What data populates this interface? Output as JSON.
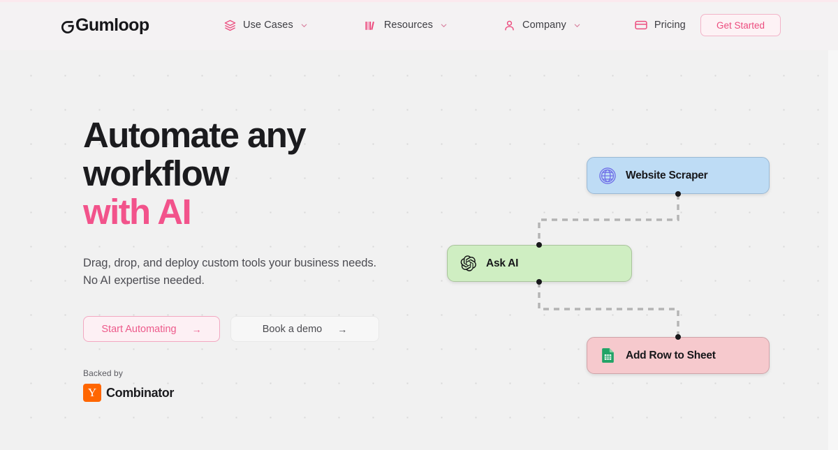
{
  "brand": {
    "name": "Gumloop",
    "accent_color": "#f2538b",
    "nav_icon_color": "#ec4c7e"
  },
  "header": {
    "nav_items": [
      {
        "label": "Use Cases",
        "icon": "layers-icon",
        "has_chevron": true
      },
      {
        "label": "Resources",
        "icon": "books-icon",
        "has_chevron": true
      },
      {
        "label": "Company",
        "icon": "person-icon",
        "has_chevron": true
      },
      {
        "label": "Pricing",
        "icon": "credit-card-icon",
        "has_chevron": false
      }
    ],
    "cta": {
      "label": "Get Started"
    }
  },
  "hero": {
    "headline_line1": "Automate any",
    "headline_line2": "workflow",
    "headline_accent": "with AI",
    "subtitle_line1": "Drag, drop, and deploy custom tools your business needs.",
    "subtitle_line2": "No AI expertise needed.",
    "primary_button": {
      "label": "Start Automating",
      "arrow": "→"
    },
    "secondary_button": {
      "label": "Book a demo",
      "arrow": "→"
    },
    "backed_by": {
      "label": "Backed by",
      "badge_letter": "Y",
      "investor": "Combinator",
      "badge_color": "#ff6600"
    }
  },
  "workflow": {
    "nodes": [
      {
        "id": "website-scraper",
        "label": "Website Scraper",
        "icon": "globe-icon",
        "fill": "#bedcf5",
        "border": "#9ab9d4"
      },
      {
        "id": "ask-ai",
        "label": "Ask AI",
        "icon": "openai-icon",
        "fill": "#cfeec2",
        "border": "#a9c39c"
      },
      {
        "id": "add-row-to-sheet",
        "label": "Add Row to Sheet",
        "icon": "google-sheets-icon",
        "fill": "#f6c9cd",
        "border": "#cfa3a8"
      }
    ],
    "connections": [
      {
        "from": "website-scraper",
        "to": "ask-ai",
        "style": "dashed"
      },
      {
        "from": "ask-ai",
        "to": "add-row-to-sheet",
        "style": "dashed"
      }
    ]
  }
}
